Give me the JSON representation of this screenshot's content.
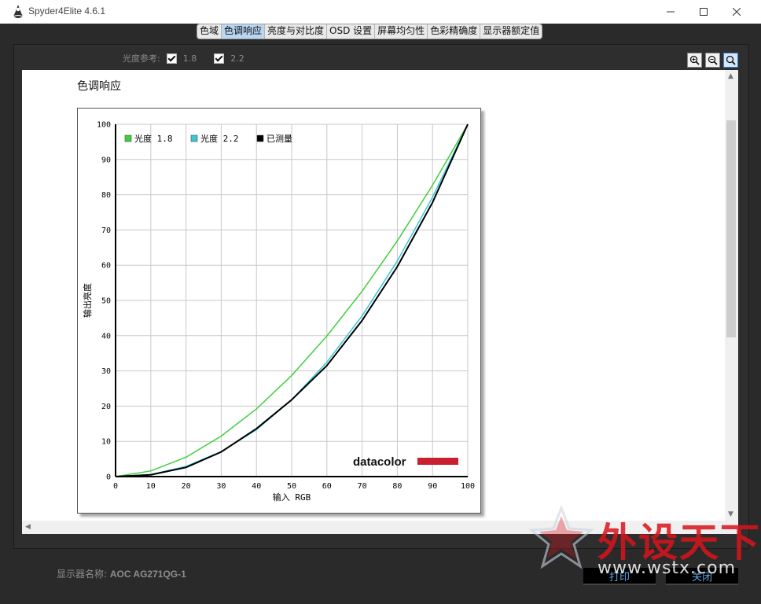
{
  "window": {
    "title": "Spyder4Elite 4.6.1"
  },
  "tabs": [
    "色域",
    "色调响应",
    "亮度与对比度",
    "OSD 设置",
    "屏幕均匀性",
    "色彩精确度",
    "显示器额定值"
  ],
  "active_tab_index": 1,
  "gamma_ref": {
    "label": "光度参考:",
    "options": [
      {
        "label": "1.8",
        "checked": true
      },
      {
        "label": "2.2",
        "checked": true
      }
    ]
  },
  "zoom_icons": [
    "zoom-in-icon",
    "zoom-out-icon",
    "zoom-actual-icon"
  ],
  "section_title": "色调响应",
  "chart_data": {
    "type": "line",
    "xlabel": "输入 RGB",
    "ylabel": "输出亮度",
    "xlim": [
      0,
      100
    ],
    "ylim": [
      0,
      100
    ],
    "xticks": [
      0,
      10,
      20,
      30,
      40,
      50,
      60,
      70,
      80,
      90,
      100
    ],
    "yticks": [
      0,
      10,
      20,
      30,
      40,
      50,
      60,
      70,
      80,
      90,
      100
    ],
    "grid": true,
    "legend_position": "top-left",
    "x": [
      0,
      10,
      20,
      30,
      40,
      50,
      60,
      70,
      80,
      90,
      100
    ],
    "series": [
      {
        "name": "光度 1.8",
        "color": "#3ecf3e",
        "values": [
          0,
          1.6,
          5.5,
          11.5,
          19.2,
          28.7,
          39.9,
          52.6,
          66.9,
          82.7,
          100
        ]
      },
      {
        "name": "光度 2.2",
        "color": "#39c6d6",
        "values": [
          0,
          0.6,
          2.9,
          7.1,
          13.3,
          21.8,
          32.5,
          45.6,
          61.2,
          79.3,
          100
        ]
      },
      {
        "name": "已测量",
        "color": "#000000",
        "values": [
          0,
          0.5,
          2.6,
          7.0,
          13.6,
          21.8,
          31.5,
          44.3,
          59.6,
          77.8,
          100
        ]
      }
    ],
    "logo_text": "datacolor"
  },
  "status": {
    "label": "显示器名称:",
    "value": "AOC AG271QG-1"
  },
  "buttons": {
    "print": "打印",
    "close": "关闭"
  },
  "watermark": {
    "text": "外设天下",
    "url": "www.wstx.com"
  },
  "colors": {
    "logo_red": "#c8202e",
    "tab_active": "#b9d6f2",
    "button_text": "#5aa7e0"
  }
}
